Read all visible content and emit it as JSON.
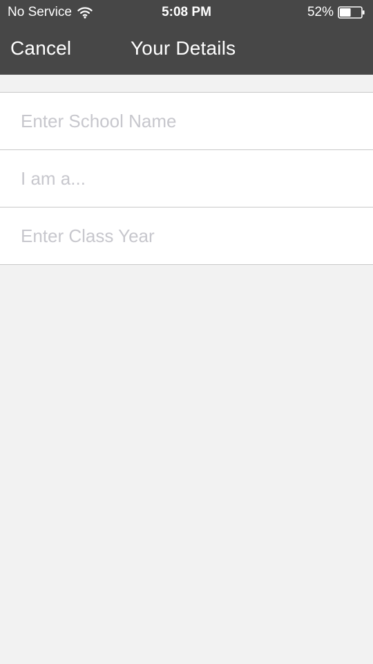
{
  "status_bar": {
    "carrier": "No Service",
    "time": "5:08 PM",
    "battery_percent": "52%",
    "battery_level": 0.52,
    "icons": [
      "wifi-icon",
      "battery-icon"
    ]
  },
  "nav": {
    "cancel_label": "Cancel",
    "title": "Your Details"
  },
  "form": {
    "school": {
      "value": "",
      "placeholder": "Enter School Name"
    },
    "role": {
      "value": "",
      "placeholder": "I am a..."
    },
    "class_year": {
      "value": "",
      "placeholder": "Enter Class Year"
    }
  },
  "colors": {
    "header_bg": "#474747",
    "header_text": "#ffffff",
    "page_bg": "#f2f2f2",
    "field_bg": "#ffffff",
    "placeholder": "#c7c7cd",
    "divider": "#c8c8c8"
  }
}
